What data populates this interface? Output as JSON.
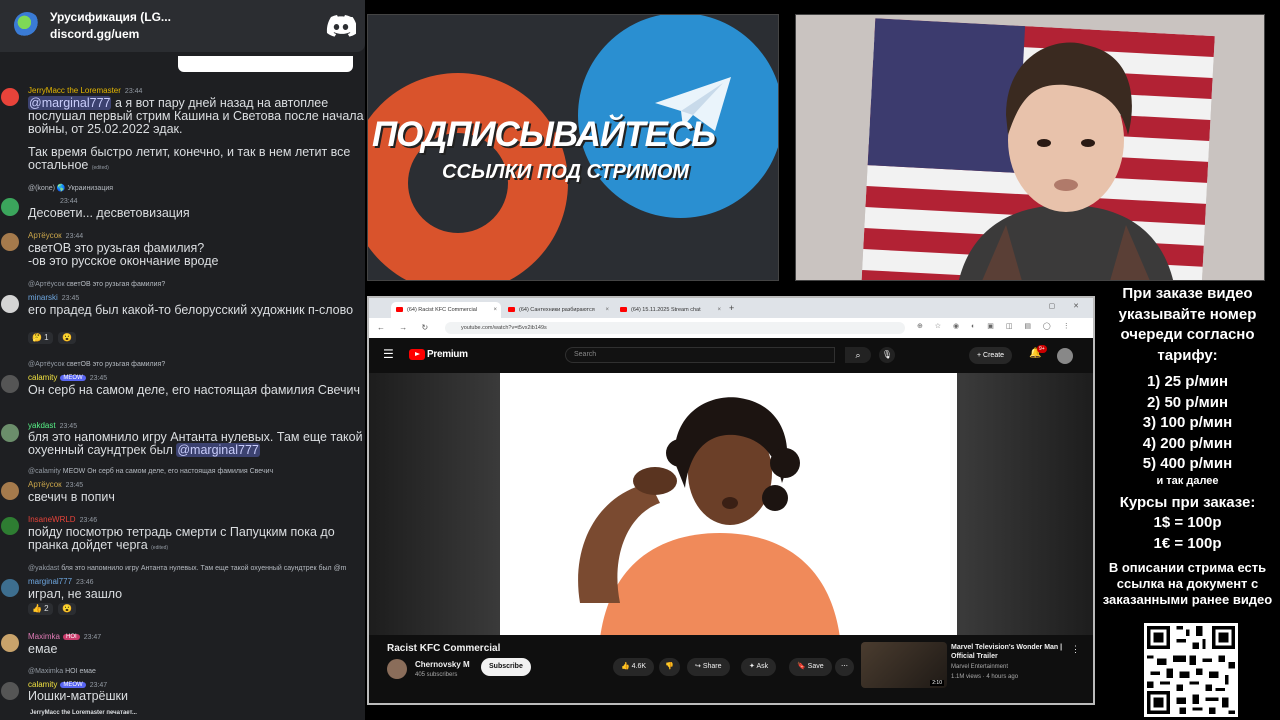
{
  "server": {
    "name": "Урусификация (LG...",
    "invite": "discord.gg/uem"
  },
  "messages": [
    {
      "author": "JerryMacc the Loremaster",
      "author_color": "#e6b800",
      "time": "23:44",
      "mention": "@marginal777",
      "text": " а я вот пару дней назад на автоплее послушал первый стрим Кашина и Светова после начала войны, от 25.02.2022 эдак.",
      "text2": "Так время быстро летит, конечно, и так в нем летит все остальное",
      "edited": "(edited)"
    },
    {
      "reply": "@(kone) 🌎 Украинизация",
      "time": "23:44",
      "text": "Десовети... десветовизация"
    },
    {
      "author": "Артёусок",
      "author_color": "#caa54a",
      "time": "23:44",
      "text": "светОВ это рузьгая фамилия?\n-ов это русское окончание вроде"
    },
    {
      "reply_author": "@Артёусок",
      "reply": "светОВ это рузьгая фамилия?",
      "author": "minarski",
      "author_color": "#6ea7e0",
      "time": "23:45",
      "text": "его прадед был какой-то белорусский художник п-слово",
      "reactions": [
        "🤔 1",
        "😮"
      ]
    },
    {
      "reply_author": "@Артёусок",
      "reply": "светОВ это рузьгая фамилия?",
      "author": "calamity",
      "author_color": "#f0e140",
      "badge": "MEOW",
      "time": "23:45",
      "text": "Он серб на самом деле, его настоящая фамилия Свечич"
    },
    {
      "author": "yakdast",
      "author_color": "#57f287",
      "time": "23:45",
      "text": "бля это напомнило игру Антанта нулевых. Там еще такой охуенный саундтрек был ",
      "mention": "@marginal777"
    },
    {
      "reply_author": "@calamity",
      "reply": "MEOW  Он серб на самом деле, его настоящая фамилия Свечич",
      "author": "Артёусок",
      "author_color": "#caa54a",
      "time": "23:45",
      "text": "свечич в попич"
    },
    {
      "author": "InsaneWRLD",
      "author_color": "#e8433a",
      "time": "23:46",
      "text": "пойду посмотрю тетрадь смерти с Папуцким пока до пранка дойдет черга",
      "edited": "(edited)"
    },
    {
      "reply_author": "@yakdast",
      "reply": "бля это напомнило игру Антанта нулевых. Там еще такой охуенный саундтрек был @m",
      "author": "marginal777",
      "author_color": "#6ea7e0",
      "time": "23:46",
      "text": "играл, не зашло",
      "reactions": [
        "👍 2",
        "😮"
      ]
    },
    {
      "author": "Maximka",
      "author_color": "#e07ab5",
      "badge": "HOI",
      "time": "23:47",
      "text": "емае"
    },
    {
      "reply_author": "@Maximka",
      "reply": "HOI  емае",
      "author": "calamity",
      "author_color": "#f0e140",
      "badge": "MEOW",
      "time": "23:47",
      "text": "Иошки-матрёшки"
    }
  ],
  "typing": "JerryMacc the Loremaster печатает...",
  "promo": {
    "title": "ПОДПИСЫВАЙТЕСЬ",
    "subtitle": "ССЫЛКИ ПОД СТРИМОМ"
  },
  "browser": {
    "tabs": [
      "(64) Racist KFC Commercial",
      "(64) Сантехники разбираются",
      "(64) 15.11.2025 Stream chat"
    ],
    "url": "youtube.com/watch?v=t5vx2ib149s"
  },
  "youtube": {
    "brand": "Premium",
    "search_placeholder": "Search",
    "create_label": "Create",
    "notif_count": "9+",
    "video_title": "Racist KFC Commercial",
    "channel": "Chernovsky M",
    "subscribers": "405 subscribers",
    "subscribe_label": "Subscribe",
    "likes": "4.6K",
    "share_label": "Share",
    "ask_label": "Ask",
    "save_label": "Save",
    "rec_title": "Marvel Television's Wonder Man | Official Trailer",
    "rec_channel": "Marvel Entertainment",
    "rec_meta": "1.1M views · 4 hours ago",
    "rec_duration": "2:10"
  },
  "info": {
    "order_note": "При заказе видео указывайте номер очереди согласно тарифу:",
    "tariffs": [
      "1) 25 р/мин",
      "2) 50 р/мин",
      "3) 100 р/мин",
      "4) 200 р/мин",
      "5) 400 р/мин"
    ],
    "etc": "и так далее",
    "rates_title": "Курсы при заказе:",
    "rates": [
      "1$ = 100р",
      "1€ = 100р"
    ],
    "doc_note": "В описании стрима есть ссылка на документ с заказанными ранее видео"
  },
  "colors": {
    "discord_bg": "#1e1f22",
    "mention_bg": "#3c4270",
    "yt_red": "#ff0000",
    "promo_red": "#d9532c",
    "promo_blue": "#2a8fd1"
  }
}
